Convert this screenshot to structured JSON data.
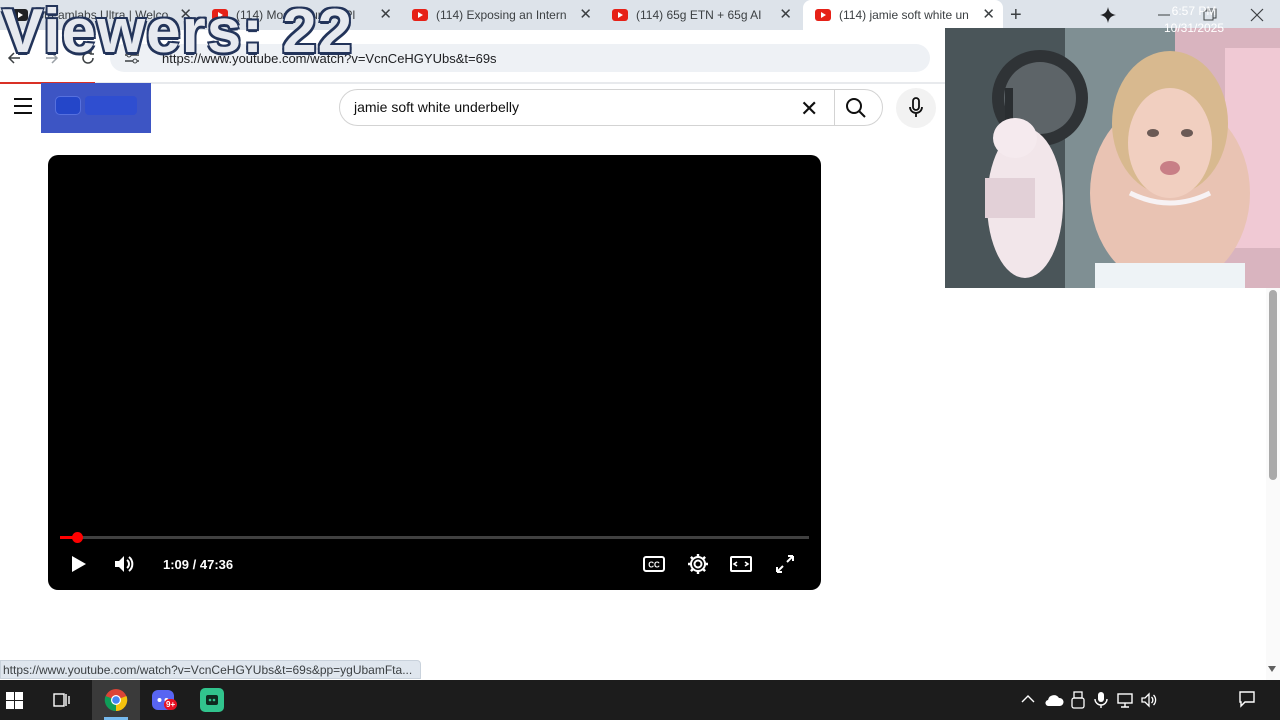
{
  "overlay": {
    "viewers_text": "Viewers: 22"
  },
  "browser": {
    "tabs": [
      {
        "title": "Streamlabs Ultra | Welco",
        "favicon": "streamlabs-icon",
        "active": false
      },
      {
        "title": "(114) Most Haunted Pl",
        "favicon": "youtube-icon",
        "active": false
      },
      {
        "title": "(114) Exposing an Intern",
        "favicon": "youtube-icon",
        "active": false
      },
      {
        "title": "(114) 65g ETN + 65g AI",
        "favicon": "youtube-icon",
        "active": false
      },
      {
        "title": "(114) jamie soft white un",
        "favicon": "youtube-icon",
        "active": true
      }
    ],
    "tab_close_glyph": "✕",
    "new_tab_glyph": "+",
    "address": "https://www.youtube.com/watch?v=VcnCeHGYUbs&t=69s",
    "address_visible": "https://www.youtube.com/watch?v=VcnCeHGYUbs&t=69s",
    "load_progress": 0.1
  },
  "youtube": {
    "search_value": "jamie soft white underbelly",
    "clear_glyph": "✕"
  },
  "player": {
    "current_time": "1:09",
    "duration": "47:36",
    "time_display": "1:09 / 47:36",
    "progress_fraction": 0.024,
    "accent_color": "#ff0000"
  },
  "status_bar": {
    "link": "https://www.youtube.com/watch?v=VcnCeHGYUbs&t=69s&pp=ygUbamFta..."
  },
  "taskbar": {
    "clock_time": "6:57 PM",
    "clock_date": "10/31/2025",
    "discord_badge": "9+"
  },
  "page_scroll_fraction": 0.0
}
